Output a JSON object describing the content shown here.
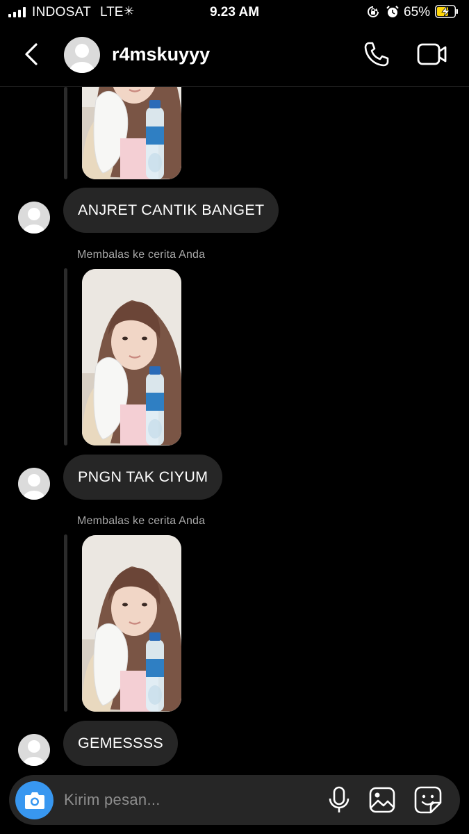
{
  "status_bar": {
    "carrier": "INDOSAT",
    "network": "LTE",
    "time": "9.23 AM",
    "battery_percent": "65%",
    "battery_level": 0.65
  },
  "header": {
    "username": "r4mskuyyy",
    "icons": [
      "back-arrow-icon",
      "phone-icon",
      "video-camera-icon"
    ]
  },
  "messages": [
    {
      "type": "incoming_text",
      "text": "ANJRET CANTIK BANGET"
    },
    {
      "type": "story_reply",
      "label": "Membalas ke cerita Anda"
    },
    {
      "type": "incoming_text",
      "text": "PNGN TAK CIYUM"
    },
    {
      "type": "story_reply",
      "label": "Membalas ke cerita Anda"
    },
    {
      "type": "incoming_text",
      "text": "GEMESSSS"
    }
  ],
  "composer": {
    "placeholder": "Kirim pesan...",
    "icons": [
      "camera-icon",
      "microphone-icon",
      "gallery-icon",
      "sticker-icon"
    ]
  },
  "colors": {
    "background": "#000000",
    "bubble": "#262626",
    "accent": "#3897f0",
    "muted_text": "#a8a8a8",
    "battery_fill": "#ffd60a"
  }
}
